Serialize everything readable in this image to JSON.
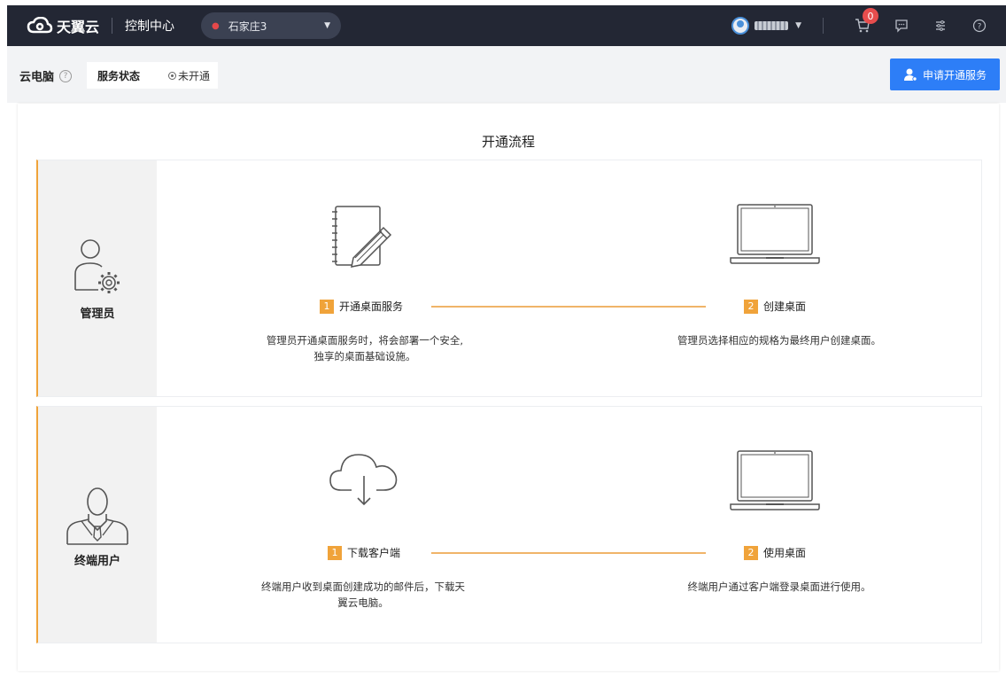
{
  "header": {
    "brand": "天翼云",
    "console_title": "控制中心",
    "region": "石家庄3",
    "cart_count": "0",
    "icons": [
      "cloud-logo-icon",
      "location-pin-icon",
      "cart-icon",
      "message-icon",
      "settings-sliders-icon",
      "help-icon"
    ]
  },
  "subheader": {
    "page_title": "云电脑",
    "status_label": "服务状态",
    "status_value": "未开通",
    "apply_button": "申请开通服务"
  },
  "main": {
    "title": "开通流程",
    "sections": [
      {
        "role": "管理员",
        "steps": [
          {
            "num": "1",
            "title": "开通桌面服务",
            "desc_line1": "管理员开通桌面服务时，将会部署一个安全,",
            "desc_line2": "独享的桌面基础设施。",
            "icon": "notebook-pen-icon"
          },
          {
            "num": "2",
            "title": "创建桌面",
            "desc_line1": "管理员选择相应的规格为最终用户创建桌面。",
            "desc_line2": "",
            "icon": "laptop-icon"
          }
        ]
      },
      {
        "role": "终端用户",
        "steps": [
          {
            "num": "1",
            "title": "下载客户端",
            "desc_line1": "终端用户收到桌面创建成功的邮件后，下载天",
            "desc_line2": "翼云电脑。",
            "icon": "cloud-download-icon"
          },
          {
            "num": "2",
            "title": "使用桌面",
            "desc_line1": "终端用户通过客户端登录桌面进行使用。",
            "desc_line2": "",
            "icon": "laptop-icon"
          }
        ]
      }
    ]
  },
  "colors": {
    "topbar": "#232734",
    "accent": "#f0a33a",
    "primary_button": "#2d7ef7",
    "badge": "#e64d4d"
  }
}
